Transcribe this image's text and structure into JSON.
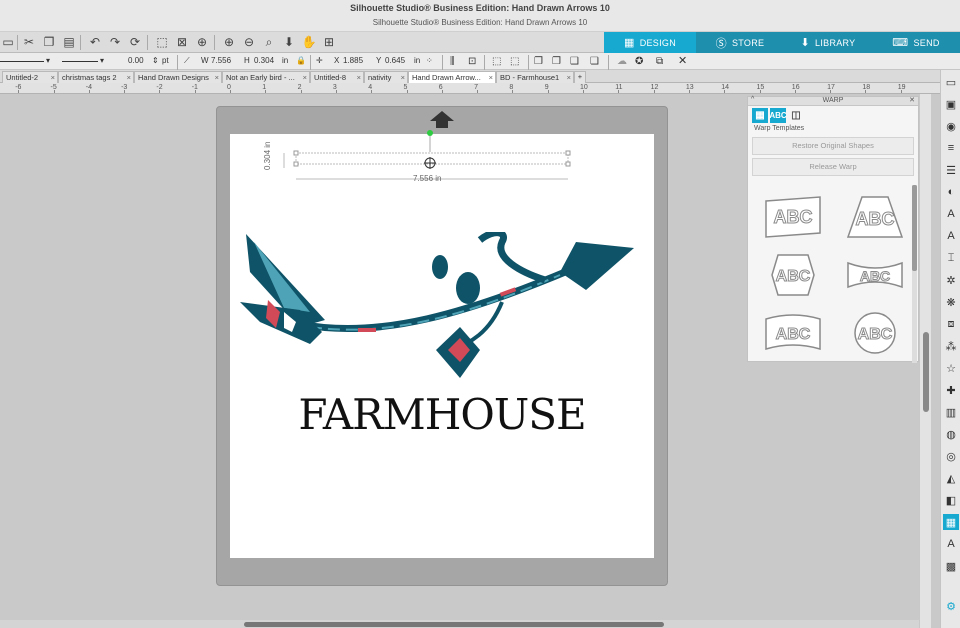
{
  "window": {
    "title": "Silhouette Studio® Business Edition: Hand Drawn Arrows 10",
    "subtitle": "Silhouette Studio® Business Edition: Hand Drawn Arrows 10"
  },
  "nav_tabs": [
    {
      "label": "DESIGN",
      "icon": "grid-icon",
      "color": "#17a9cf"
    },
    {
      "label": "STORE",
      "icon": "silhouette-s-icon",
      "color": "#1f8fae"
    },
    {
      "label": "LIBRARY",
      "icon": "download-icon",
      "color": "#1f8fae"
    },
    {
      "label": "SEND",
      "icon": "cutter-icon",
      "color": "#1f8fae"
    }
  ],
  "line_toolbar": {
    "line_width": "0.00",
    "line_unit": "pt",
    "w_label": "W",
    "w_value": "7.556",
    "h_label": "H",
    "h_value": "0.304",
    "unit": "in",
    "x_label": "X",
    "x_value": "1.885",
    "y_label": "Y",
    "y_value": "0.645",
    "unit2": "in"
  },
  "doc_tabs": [
    "Untitled-2",
    "christmas tags 2",
    "Hand Drawn Designs",
    "Not an Early bird - ...",
    "Untitled-8",
    "nativity",
    "Hand Drawn Arrow...",
    "BD - Farmhouse1"
  ],
  "active_tab_index": 6,
  "ruler_ticks": [
    "-6",
    "-5",
    "-4",
    "-3",
    "-2",
    "-1",
    "0",
    "1",
    "2",
    "3",
    "4",
    "5",
    "6",
    "7",
    "8",
    "9",
    "10",
    "11",
    "12",
    "13",
    "14",
    "15",
    "16",
    "17",
    "18",
    "19"
  ],
  "selection": {
    "width_label": "7.556 in",
    "height_label": "0.304 in"
  },
  "canvas": {
    "text": "FARMHOUSE",
    "arrow_color": "#0e5367",
    "arrow_accent": "#d24a57",
    "arrow_light": "#4fa3b6"
  },
  "warp_panel": {
    "title": "WARP",
    "subtitle": "Warp Templates",
    "restore_button": "Restore Original Shapes",
    "release_button": "Release Warp",
    "template_text": "ABC",
    "icon_label": "ABC"
  }
}
